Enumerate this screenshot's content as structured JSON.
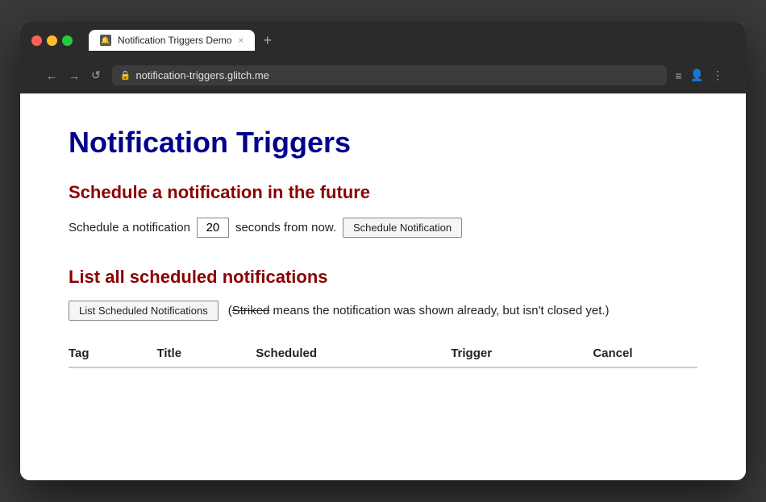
{
  "browser": {
    "traffic_lights": [
      "red",
      "yellow",
      "green"
    ],
    "tab": {
      "title": "Notification Triggers Demo",
      "favicon": "🔔",
      "close": "×"
    },
    "tab_new_label": "+",
    "nav": {
      "back": "←",
      "forward": "→",
      "refresh": "↺"
    },
    "url": "notification-triggers.glitch.me",
    "url_right_icons": [
      "≡",
      "👤",
      "⋮"
    ]
  },
  "page": {
    "title": "Notification Triggers",
    "schedule_section": {
      "heading": "Schedule a notification in the future",
      "label_before": "Schedule a notification",
      "input_value": "20",
      "label_after": "seconds from now.",
      "button_label": "Schedule Notification"
    },
    "list_section": {
      "heading": "List all scheduled notifications",
      "button_label": "List Scheduled Notifications",
      "note_prefix": "(",
      "note_striked": "Striked",
      "note_suffix": " means the notification was shown already, but isn't closed yet.)",
      "table": {
        "columns": [
          "Tag",
          "Title",
          "Scheduled",
          "Trigger",
          "Cancel"
        ],
        "rows": []
      }
    }
  }
}
